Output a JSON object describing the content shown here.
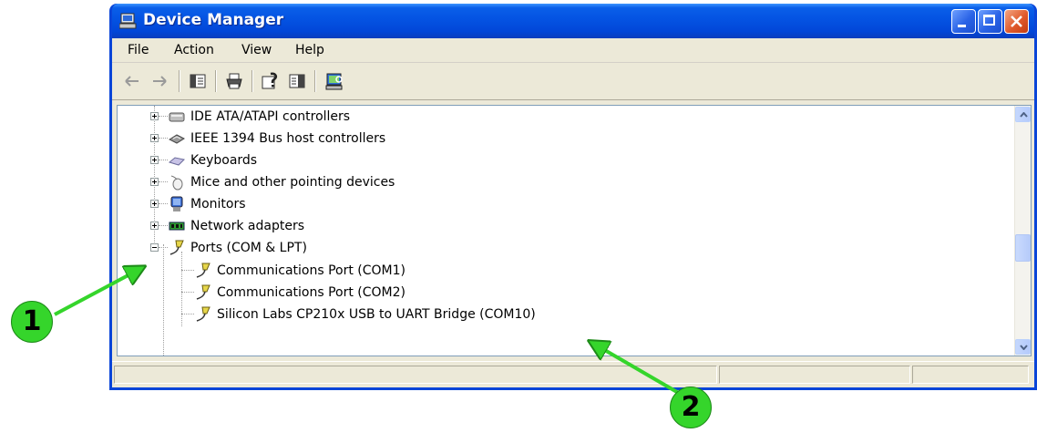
{
  "window": {
    "title": "Device Manager"
  },
  "menu": {
    "file": "File",
    "action": "Action",
    "view": "View",
    "help": "Help"
  },
  "toolbar": {
    "icons": [
      "back-arrow-icon",
      "forward-arrow-icon",
      "properties-pane-icon",
      "print-icon",
      "help-icon",
      "detail-pane-icon",
      "scan-hardware-icon"
    ]
  },
  "tree": {
    "items": [
      {
        "label": "IDE ATA/ATAPI controllers",
        "expanded": false
      },
      {
        "label": "IEEE 1394 Bus host controllers",
        "expanded": false
      },
      {
        "label": "Keyboards",
        "expanded": false
      },
      {
        "label": "Mice and other pointing devices",
        "expanded": false
      },
      {
        "label": "Monitors",
        "expanded": false
      },
      {
        "label": "Network adapters",
        "expanded": false
      },
      {
        "label": "Ports (COM & LPT)",
        "expanded": true,
        "children": [
          {
            "label": "Communications Port (COM1)"
          },
          {
            "label": "Communications Port (COM2)"
          },
          {
            "label": "Silicon Labs CP210x USB to UART Bridge (COM10)"
          }
        ]
      }
    ]
  },
  "annotations": {
    "callout_1": "1",
    "callout_2": "2"
  },
  "colors": {
    "titlebar": "#0453e2",
    "callout": "#35d52b",
    "window_bg": "#ece9d8"
  }
}
